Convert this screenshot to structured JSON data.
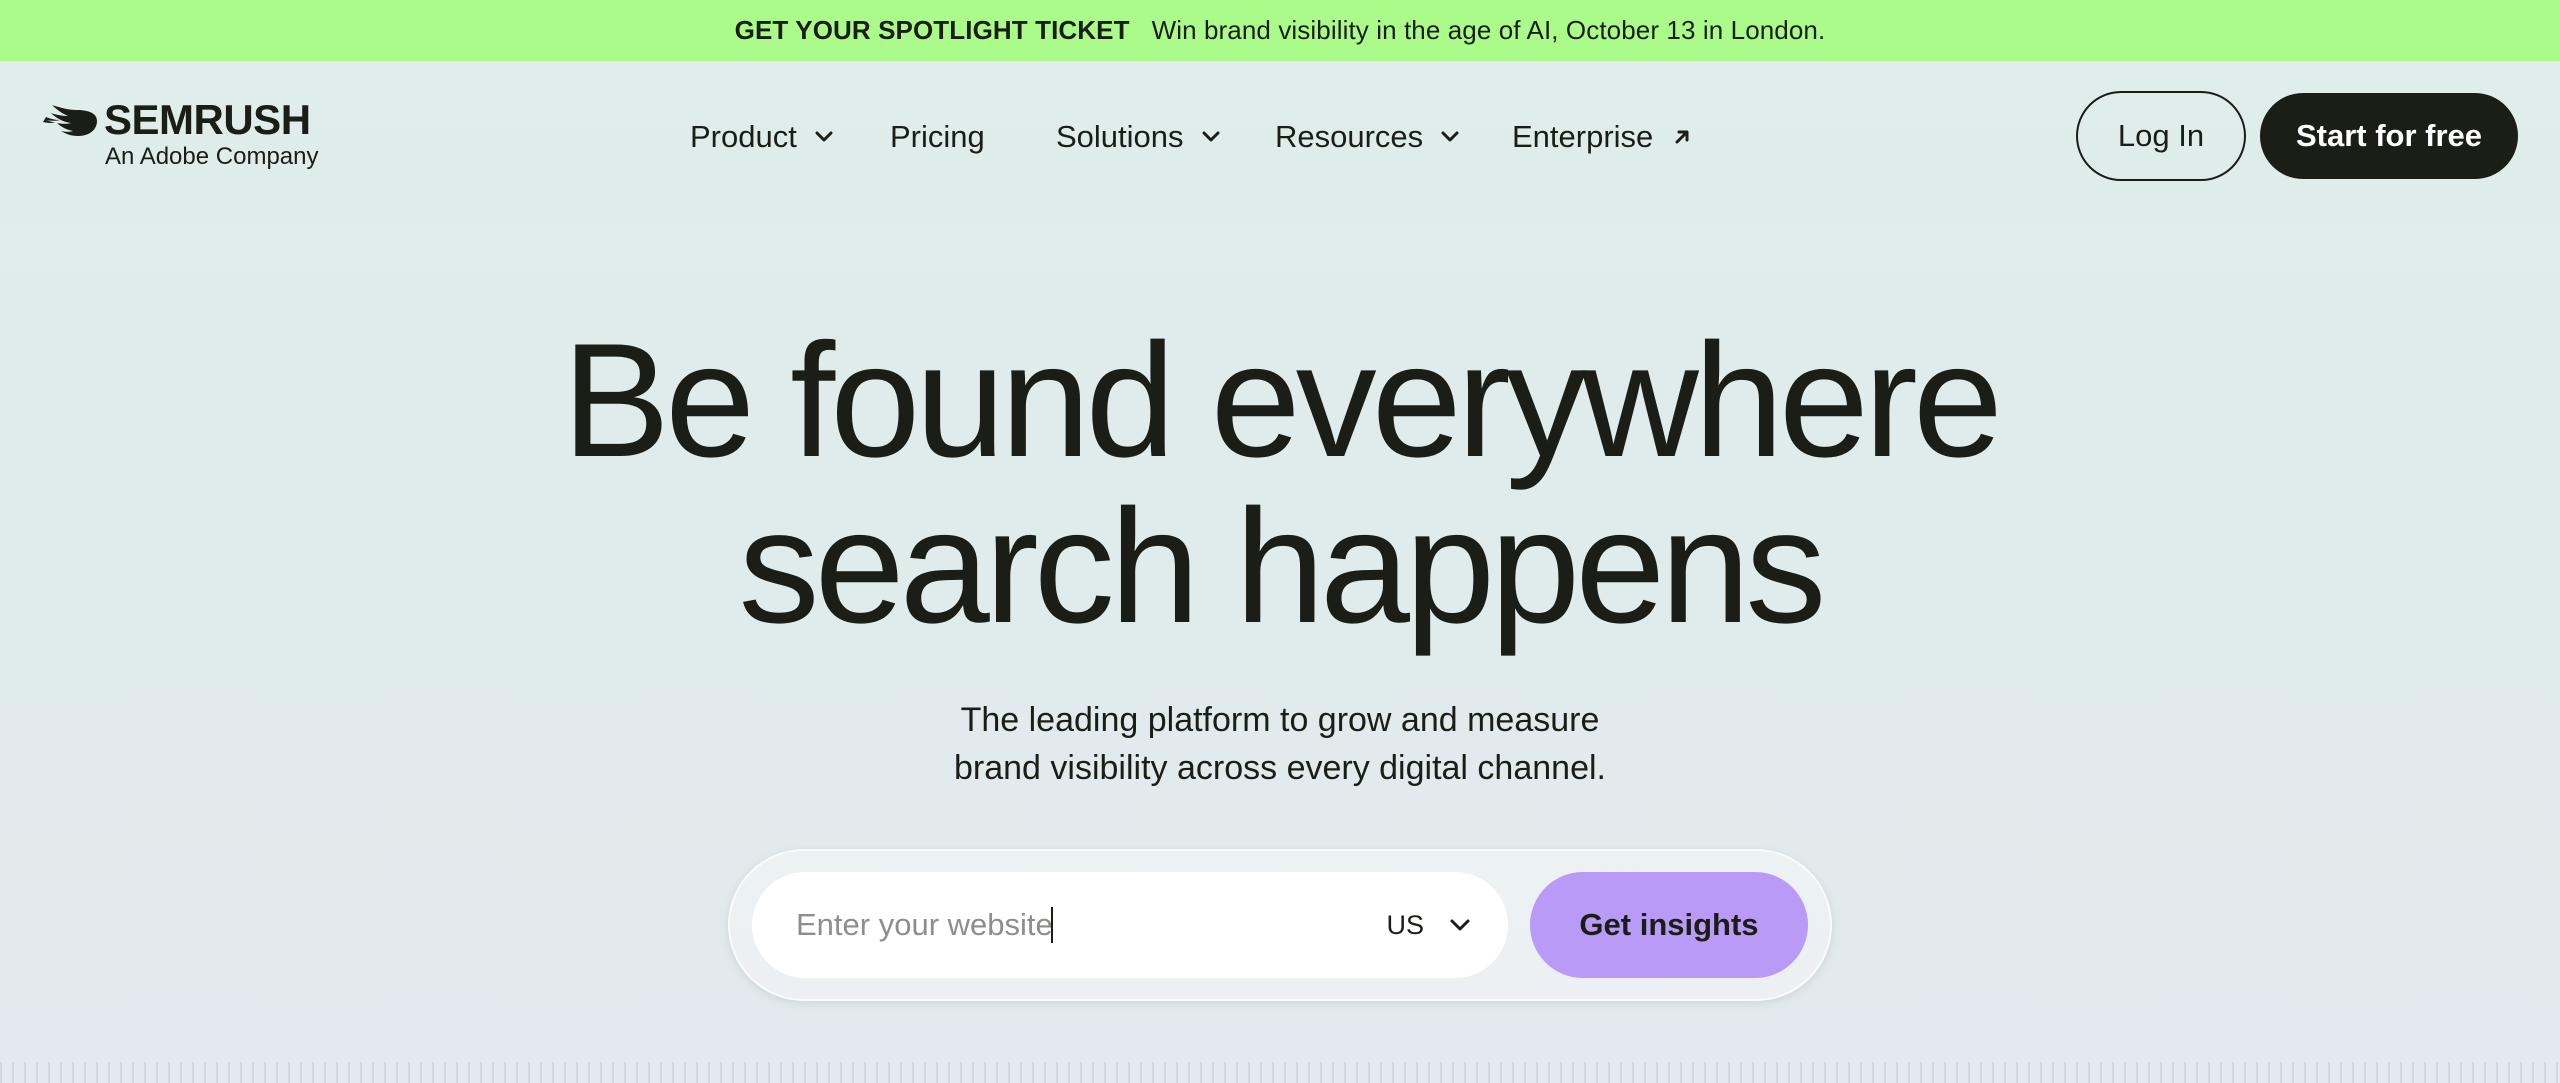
{
  "banner": {
    "highlight": "GET YOUR SPOTLIGHT TICKET",
    "message": "Win brand visibility in the age of AI, October 13 in London.",
    "background_color": "#abfb8a"
  },
  "header": {
    "logo": {
      "wordmark": "SEMRUSH",
      "subtitle": "An Adobe Company",
      "icon": "semrush-flame-icon"
    },
    "nav": [
      {
        "label": "Product",
        "icon": "chevron-down-icon"
      },
      {
        "label": "Pricing"
      },
      {
        "label": "Solutions",
        "icon": "chevron-down-icon"
      },
      {
        "label": "Resources",
        "icon": "chevron-down-icon"
      },
      {
        "label": "Enterprise",
        "icon": "arrow-up-right-icon"
      }
    ],
    "login_label": "Log In",
    "start_label": "Start for free"
  },
  "hero": {
    "title_line1": "Be found everywhere",
    "title_line2": "search happens",
    "subtitle_line1": "The leading platform to grow and measure",
    "subtitle_line2": "brand visibility across every digital channel."
  },
  "search": {
    "placeholder": "Enter your website",
    "value": "",
    "region": "US",
    "region_icon": "chevron-down-icon",
    "submit_label": "Get insights",
    "submit_color": "#b99af7"
  },
  "colors": {
    "text": "#1b1e17",
    "dark_button": "#1b1e17",
    "page_background": "#dfeeea"
  }
}
